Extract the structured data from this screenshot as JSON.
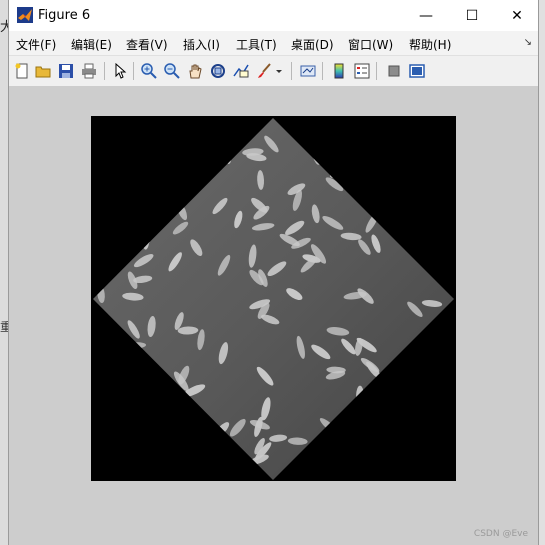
{
  "background": {
    "left_glyph_top": "大",
    "left_glyph_mid": "重"
  },
  "window": {
    "title": "Figure 6",
    "controls": {
      "minimize": "—",
      "maximize": "☐",
      "close": "✕"
    }
  },
  "menu": {
    "items": [
      {
        "label": "文件(F)"
      },
      {
        "label": "编辑(E)"
      },
      {
        "label": "查看(V)"
      },
      {
        "label": "插入(I)"
      },
      {
        "label": "工具(T)"
      },
      {
        "label": "桌面(D)"
      },
      {
        "label": "窗口(W)"
      },
      {
        "label": "帮助(H)"
      }
    ],
    "overflow_icon": "corner-arrow-icon"
  },
  "toolbar": {
    "icons": [
      "new-figure-icon",
      "open-file-icon",
      "save-icon",
      "print-icon",
      "edit-plot-arrow-icon",
      "zoom-in-icon",
      "zoom-out-icon",
      "pan-hand-icon",
      "rotate-3d-icon",
      "data-cursor-icon",
      "brush-icon",
      "brush-dropdown-icon",
      "link-plot-icon",
      "insert-colorbar-icon",
      "insert-legend-icon",
      "hide-plot-tools-icon",
      "show-plot-tools-icon"
    ]
  },
  "figure": {
    "image_description": "rotated grayscale image of rice grains",
    "rotation_deg": 45,
    "colors": {
      "axes_bg": "#000000",
      "figure_bg": "#cdcdcd",
      "image_base": "#6e6e6e",
      "grain": "#c8c8c8"
    }
  },
  "watermark": "CSDN @Eve"
}
